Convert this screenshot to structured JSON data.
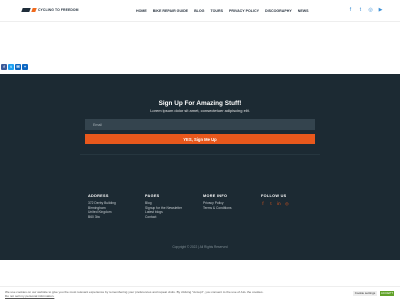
{
  "header": {
    "logo_text": "CYCLING TO FREEDOM",
    "nav": [
      "HOME",
      "BIKE REPAIR GUIDE",
      "BLOG",
      "TOURS",
      "PRIVACY POLICY",
      "DISCOGRAPHY",
      "NEWS"
    ],
    "social": [
      {
        "icon": "facebook-icon",
        "glyph": "f"
      },
      {
        "icon": "twitter-icon",
        "glyph": "t"
      },
      {
        "icon": "instagram-icon",
        "glyph": "◎"
      },
      {
        "icon": "youtube-icon",
        "glyph": "▶"
      }
    ]
  },
  "share": [
    {
      "icon": "facebook-share-icon",
      "glyph": "f",
      "color": "#3b5998"
    },
    {
      "icon": "twitter-share-icon",
      "glyph": "t",
      "color": "#1da1f2"
    },
    {
      "icon": "email-share-icon",
      "glyph": "✉",
      "color": "#0b66c2"
    },
    {
      "icon": "more-share-icon",
      "glyph": "+",
      "color": "#0b66c2"
    }
  ],
  "signup": {
    "title": "Sign Up For Amazing Stuff!",
    "subtitle": "Lorem ipsum dolor sit amet, consectetuer adipiscing elit.",
    "email_placeholder": "Email",
    "button_label": "YES, Sign Me Up"
  },
  "footer": {
    "address": {
      "heading": "ADDRESS",
      "lines": [
        "372 Derby Building",
        "Birmingham",
        "United Kingdom",
        "B60 3bc"
      ]
    },
    "pages": {
      "heading": "PAGES",
      "links": [
        "Blog",
        "Signup for the Newsletter",
        "Latest blogs",
        "Contact"
      ]
    },
    "more_info": {
      "heading": "MORE INFO",
      "links": [
        "Privacy Policy",
        "Terms & Conditions"
      ]
    },
    "follow_us": {
      "heading": "FOLLOW US",
      "icons": [
        {
          "icon": "facebook-icon",
          "glyph": "f"
        },
        {
          "icon": "twitter-icon",
          "glyph": "t"
        },
        {
          "icon": "linkedin-icon",
          "glyph": "in"
        },
        {
          "icon": "instagram-icon",
          "glyph": "◎"
        }
      ]
    },
    "copyright": "Copyright © 2022 | All Rights Reserved"
  },
  "cookie": {
    "text": "We use cookies on our website to give you the most relevant experience by remembering your preferences and repeat visits. By clicking \"Accept\", you consent to the use of ALL the cookies.",
    "link_text": "Do not sell my personal information.",
    "settings_label": "Cookie settings",
    "accept_label": "ACCEPT"
  },
  "colors": {
    "accent": "#e8581c",
    "dark_bg": "#1c2a33",
    "social_blue": "#3b8fd6",
    "accept_green": "#61a229"
  }
}
